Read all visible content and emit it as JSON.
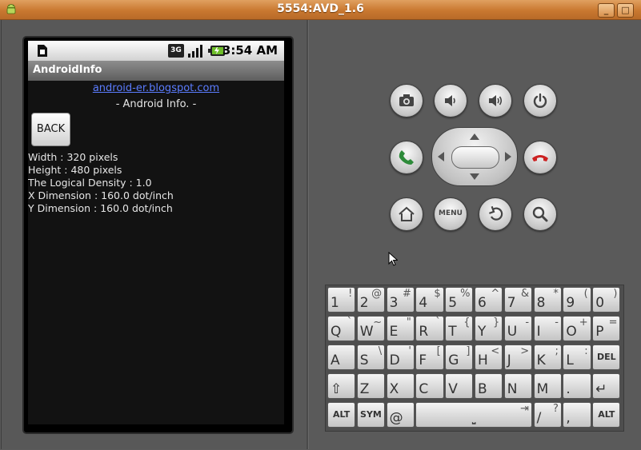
{
  "window": {
    "title": "5554:AVD_1.6",
    "minimize_label": "_",
    "maximize_label": "□",
    "close_label": "✕"
  },
  "device": {
    "status_bar": {
      "time": "3:54 AM",
      "network_label": "3G",
      "icons": [
        "sim-icon",
        "3g-icon",
        "signal-icon",
        "battery-icon"
      ]
    },
    "app_title": "AndroidInfo",
    "link_text": "android-er.blogspot.com",
    "subtitle": "- Android Info. -",
    "back_label": "BACK",
    "info_lines": [
      "Width : 320 pixels",
      "Height : 480 pixels",
      "The Logical Density : 1.0",
      "X Dimension : 160.0 dot/inch",
      "Y Dimension : 160.0 dot/inch"
    ]
  },
  "controls": {
    "menu_label": "MENU",
    "accent_call": "#2e8b3a",
    "accent_endcall": "#cc2222"
  },
  "keyboard": {
    "rows": [
      [
        [
          "1",
          "!"
        ],
        [
          "2",
          "@"
        ],
        [
          "3",
          "#"
        ],
        [
          "4",
          "$"
        ],
        [
          "5",
          "%"
        ],
        [
          "6",
          "^"
        ],
        [
          "7",
          "&"
        ],
        [
          "8",
          "*"
        ],
        [
          "9",
          "("
        ],
        [
          "0",
          ")"
        ]
      ],
      [
        [
          "Q",
          "`"
        ],
        [
          "W",
          "~"
        ],
        [
          "E",
          "\""
        ],
        [
          "R",
          "`"
        ],
        [
          "T",
          "{"
        ],
        [
          "Y",
          "}"
        ],
        [
          "U",
          "-"
        ],
        [
          "I",
          "-"
        ],
        [
          "O",
          "+"
        ],
        [
          "P",
          "="
        ]
      ],
      [
        [
          "A",
          ""
        ],
        [
          "S",
          "\\"
        ],
        [
          "D",
          "'"
        ],
        [
          "F",
          "["
        ],
        [
          "G",
          "]"
        ],
        [
          "H",
          "<"
        ],
        [
          "J",
          ">"
        ],
        [
          "K",
          ";"
        ],
        [
          "L",
          ":"
        ],
        [
          "DEL",
          ""
        ]
      ],
      [
        [
          "⇧",
          ""
        ],
        [
          "Z",
          ""
        ],
        [
          "X",
          ""
        ],
        [
          "C",
          ""
        ],
        [
          "V",
          ""
        ],
        [
          "B",
          ""
        ],
        [
          "N",
          ""
        ],
        [
          "M",
          ""
        ],
        [
          ".",
          ""
        ],
        [
          "↵",
          ""
        ]
      ],
      [
        [
          "ALT",
          ""
        ],
        [
          "SYM",
          ""
        ],
        [
          "@",
          ""
        ],
        [
          "SPACE",
          "⇥"
        ],
        [
          "/",
          "?"
        ],
        [
          ",",
          ""
        ],
        [
          "ALT",
          ""
        ]
      ]
    ]
  }
}
